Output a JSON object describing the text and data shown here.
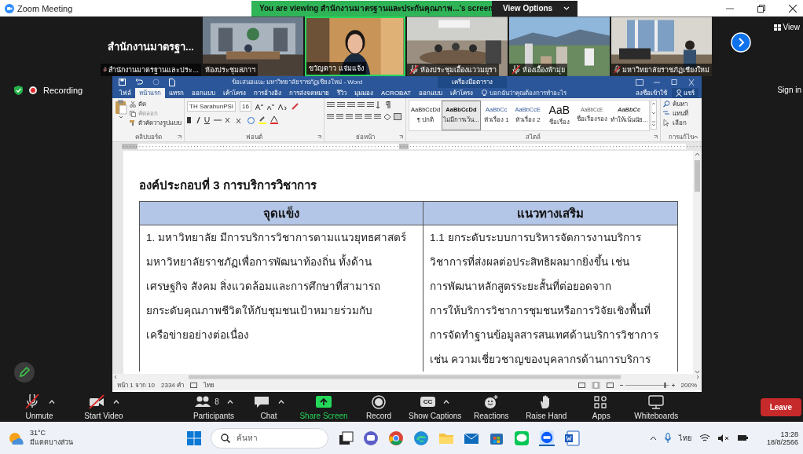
{
  "window": {
    "title": "Zoom Meeting"
  },
  "share_banner": {
    "text": "You are viewing สำนักงานมาตรฐานและประกันคุณภาพ...'s screen",
    "view_options": "View Options"
  },
  "gallery": {
    "tiles": [
      {
        "kind": "name",
        "name": "สำนักงานมาตรฐา...",
        "caption": "สำนักงานมาตรฐานและประ...",
        "muted": true,
        "speaking": false
      },
      {
        "kind": "hall",
        "caption": "ห้องประชุมสภาฯ",
        "muted": false,
        "speaking": false
      },
      {
        "kind": "person",
        "caption": "ขวัญดาว แจ่มแจ้ง",
        "muted": false,
        "speaking": true
      },
      {
        "kind": "room",
        "caption": "ห้องประชุมเอื้องแววมยุรา",
        "muted": true,
        "speaking": false
      },
      {
        "kind": "city",
        "caption": "ห้องเอื้องฟ้ามุ่ย",
        "muted": true,
        "speaking": false
      },
      {
        "kind": "office",
        "caption": "มหาวิทยาลัยราชภัฏเชียงใหม่",
        "muted": true,
        "speaking": false
      }
    ]
  },
  "view": "View",
  "recording": "Recording",
  "sign_in": "Sign in",
  "word": {
    "title": "ข้อเสนอแนะ มหาวิทยาลัยราชภัฏเชียงใหม่ - Word",
    "context_group": "เครื่องมือตาราง",
    "tabs": [
      {
        "label": "ไฟล์",
        "selected": false
      },
      {
        "label": "หน้าแรก",
        "selected": true
      },
      {
        "label": "แทรก",
        "selected": false
      },
      {
        "label": "ออกแบบ",
        "selected": false
      },
      {
        "label": "เค้าโครง",
        "selected": false
      },
      {
        "label": "การอ้างอิง",
        "selected": false
      },
      {
        "label": "การส่งจดหมาย",
        "selected": false
      },
      {
        "label": "รีวิว",
        "selected": false
      },
      {
        "label": "มุมมอง",
        "selected": false
      },
      {
        "label": "ACROBAT",
        "selected": false
      },
      {
        "label": "ออกแบบ",
        "selected": false
      },
      {
        "label": "เค้าโครง",
        "selected": false
      }
    ],
    "tell_me": "บอกฉันว่าคุณต้องการทำอะไร",
    "account": "ลงชื่อเข้าใช้",
    "share": "แชร์",
    "clipboard": {
      "cut": "ตัด",
      "copy": "คัดลอก",
      "format_painter": "ตัวคัดวางรูปแบบ",
      "label": "คลิปบอร์ด"
    },
    "font": {
      "name": "TH SarabunPSI",
      "size": "16",
      "label": "ฟอนต์"
    },
    "paragraph_label": "ย่อหน้า",
    "styles": {
      "label": "สไตล์",
      "items": [
        {
          "kind": "normal",
          "preview": "AaBbCcDd",
          "name": "¶ ปกติ",
          "selected": false
        },
        {
          "kind": "strong",
          "preview": "AaBbCcDd",
          "name": "ไม่มีการเว้น...",
          "selected": true
        },
        {
          "kind": "heading",
          "preview": "AaBbCc",
          "name": "หัวเรื่อง 1",
          "selected": false
        },
        {
          "kind": "heading",
          "preview": "AaBbCcE",
          "name": "หัวเรื่อง 2",
          "selected": false
        },
        {
          "kind": "title",
          "preview": "AaB",
          "name": "ชื่อเรื่อง",
          "selected": false
        },
        {
          "kind": "subtle",
          "preview": "AaBbCcE",
          "name": "ชื่อเรื่องรอง",
          "selected": false
        },
        {
          "kind": "emphasis",
          "preview": "AaBbCc",
          "name": "ทำให้เน้นนัย...",
          "selected": false
        }
      ]
    },
    "editing": {
      "label": "การแก้ไข",
      "items": [
        "ค้นหา",
        "แทนที่",
        "เลือก"
      ]
    },
    "document": {
      "heading": "องค์ประกอบที่ 3 การบริการวิชาการ",
      "columns": [
        "จุดแข็ง",
        "แนวทางเสริม"
      ],
      "cells": [
        [
          "1. มหาวิทยาลัย มีการบริการวิชาการตามแนวยุทธศาสตร์",
          "มหาวิทยาลัยราชภัฏเพื่อการพัฒนาท้องถิ่น ทั้งด้าน",
          "เศรษฐกิจ สังคม สิ่งแวดล้อมและการศึกษาที่สามารถ",
          "ยกระดับคุณภาพชีวิตให้กับชุมชนเป้าหมายร่วมกับ",
          "เครือข่ายอย่างต่อเนื่อง"
        ],
        [
          "1.1 ยกระดับระบบการบริหารจัดการงานบริการ",
          "วิชาการที่ส่งผลต่อประสิทธิผลมากยิ่งขึ้น เช่น",
          "การพัฒนาหลักสูตรระยะสั้นที่ต่อยอดจาก",
          "การให้บริการวิชาการชุมชนหรือการวิจัยเชิงพื้นที่",
          "การจัดทำฐานข้อมูลสารสนเทศด้านบริการวิชาการ",
          "เช่น ความเชี่ยวชาญของบุคลากรด้านการบริการ"
        ]
      ]
    },
    "status": {
      "page": "หน้า 1 จาก 10",
      "words": "2334 คำ",
      "language": "ไทย",
      "zoom_slider": {
        "level": 0.82
      },
      "zoom": "200%"
    }
  },
  "toolbar": {
    "controls": [
      {
        "kind": "mic",
        "label": "Unmute",
        "muted": true,
        "menu": true
      },
      {
        "kind": "video",
        "label": "Start Video",
        "muted": true,
        "menu": true
      },
      {
        "kind": "participants",
        "label": "Participants",
        "count": "8",
        "menu": true
      },
      {
        "kind": "chat",
        "label": "Chat",
        "menu": true
      },
      {
        "kind": "share",
        "label": "Share Screen",
        "menu": false
      },
      {
        "kind": "record",
        "label": "Record",
        "menu": false
      },
      {
        "kind": "captions",
        "label": "Show Captions",
        "icon_text": "CC",
        "menu": true
      },
      {
        "kind": "reactions",
        "label": "Reactions",
        "menu": false
      },
      {
        "kind": "hand",
        "label": "Raise Hand",
        "menu": false
      },
      {
        "kind": "apps",
        "label": "Apps",
        "menu": false
      },
      {
        "kind": "whiteboards",
        "label": "Whiteboards",
        "menu": false
      }
    ],
    "leave": "Leave"
  },
  "taskbar": {
    "weather": {
      "temperature": "31°C",
      "condition": "มีแดดบางส่วน"
    },
    "search": {
      "placeholder": "ค้นหา"
    },
    "language": "ไทย",
    "time": "13:28",
    "date": "18/8/2566"
  }
}
